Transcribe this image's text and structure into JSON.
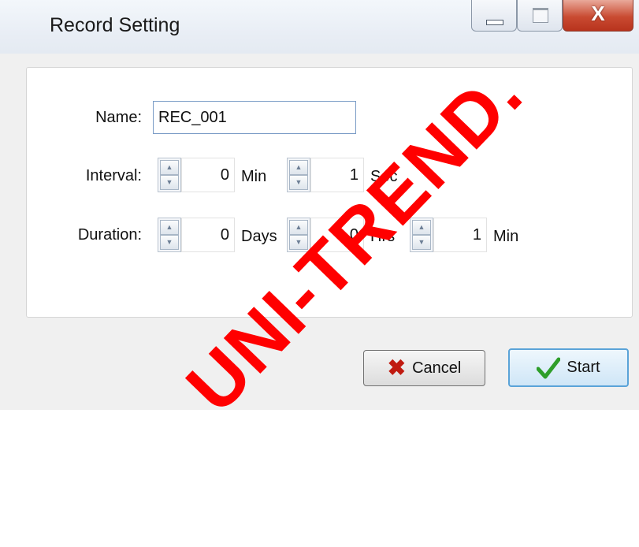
{
  "window": {
    "title": "Record Setting",
    "controls": {
      "minimize_icon": "minimize-icon",
      "maximize_icon": "maximize-icon",
      "close_label": "X"
    }
  },
  "form": {
    "name_label": "Name:",
    "name_value": "REC_001",
    "interval_label": "Interval:",
    "interval": {
      "min_value": "0",
      "min_unit": "Min",
      "sec_value": "1",
      "sec_unit": "Sec"
    },
    "duration_label": "Duration:",
    "duration": {
      "days_value": "0",
      "days_unit": "Days",
      "hrs_value": "0",
      "hrs_unit": "Hrs",
      "min_value": "1",
      "min_unit": "Min"
    }
  },
  "buttons": {
    "cancel_label": "Cancel",
    "start_label": "Start"
  },
  "watermark": "UNI-TREND.",
  "colors": {
    "accent": "#5aa3d8",
    "cancel_icon": "#c01a10",
    "start_icon": "#2e9e2a",
    "watermark": "#ff0000"
  }
}
